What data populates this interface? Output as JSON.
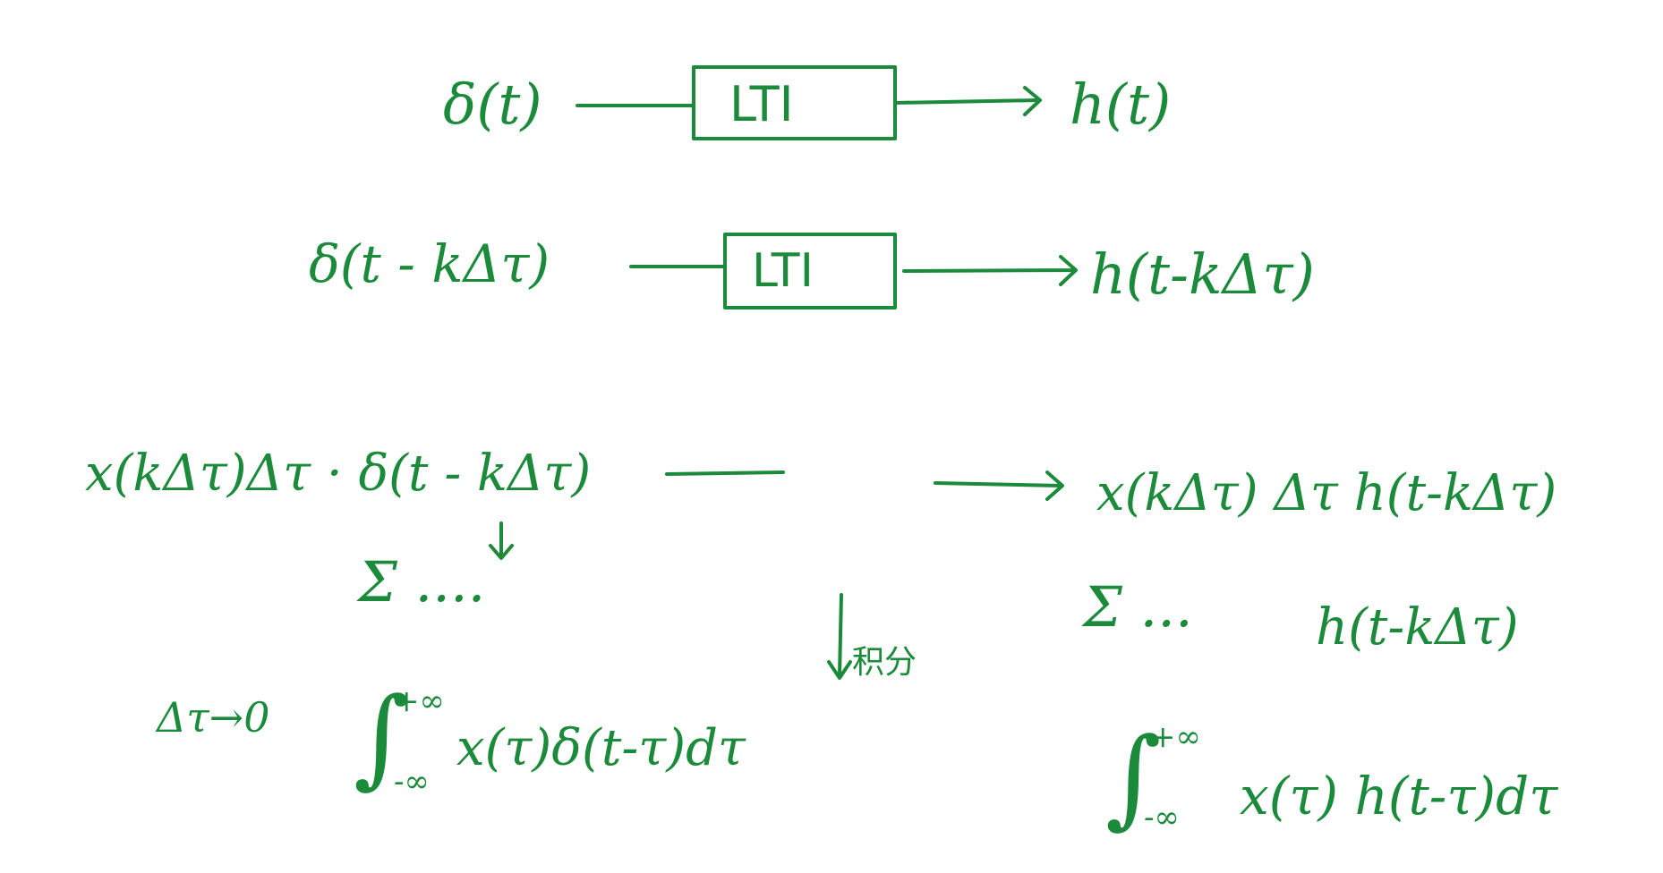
{
  "ink_color": "#1b8a3a",
  "row1": {
    "input": "δ(t)",
    "block": "LTI",
    "output": "h(t)"
  },
  "row2": {
    "input": "δ(t - kΔτ)",
    "block": "LTI",
    "output": "h(t-kΔτ)"
  },
  "row3": {
    "input": "x(kΔτ)Δτ · δ(t - kΔτ)",
    "output": "x(kΔτ) Δτ h(t-kΔτ)"
  },
  "row4": {
    "left": "Σ ....",
    "right": "Σ ...",
    "right_term": "h(t-kΔτ)"
  },
  "limit": {
    "label": "Δτ→0",
    "side_label": "积分"
  },
  "row5": {
    "left_upper": "+∞",
    "left_lower": "-∞",
    "left_integrand": "x(τ)δ(t-τ)dτ",
    "right_upper": "+∞",
    "right_lower": "-∞",
    "right_integrand": "x(τ) h(t-τ)dτ"
  }
}
